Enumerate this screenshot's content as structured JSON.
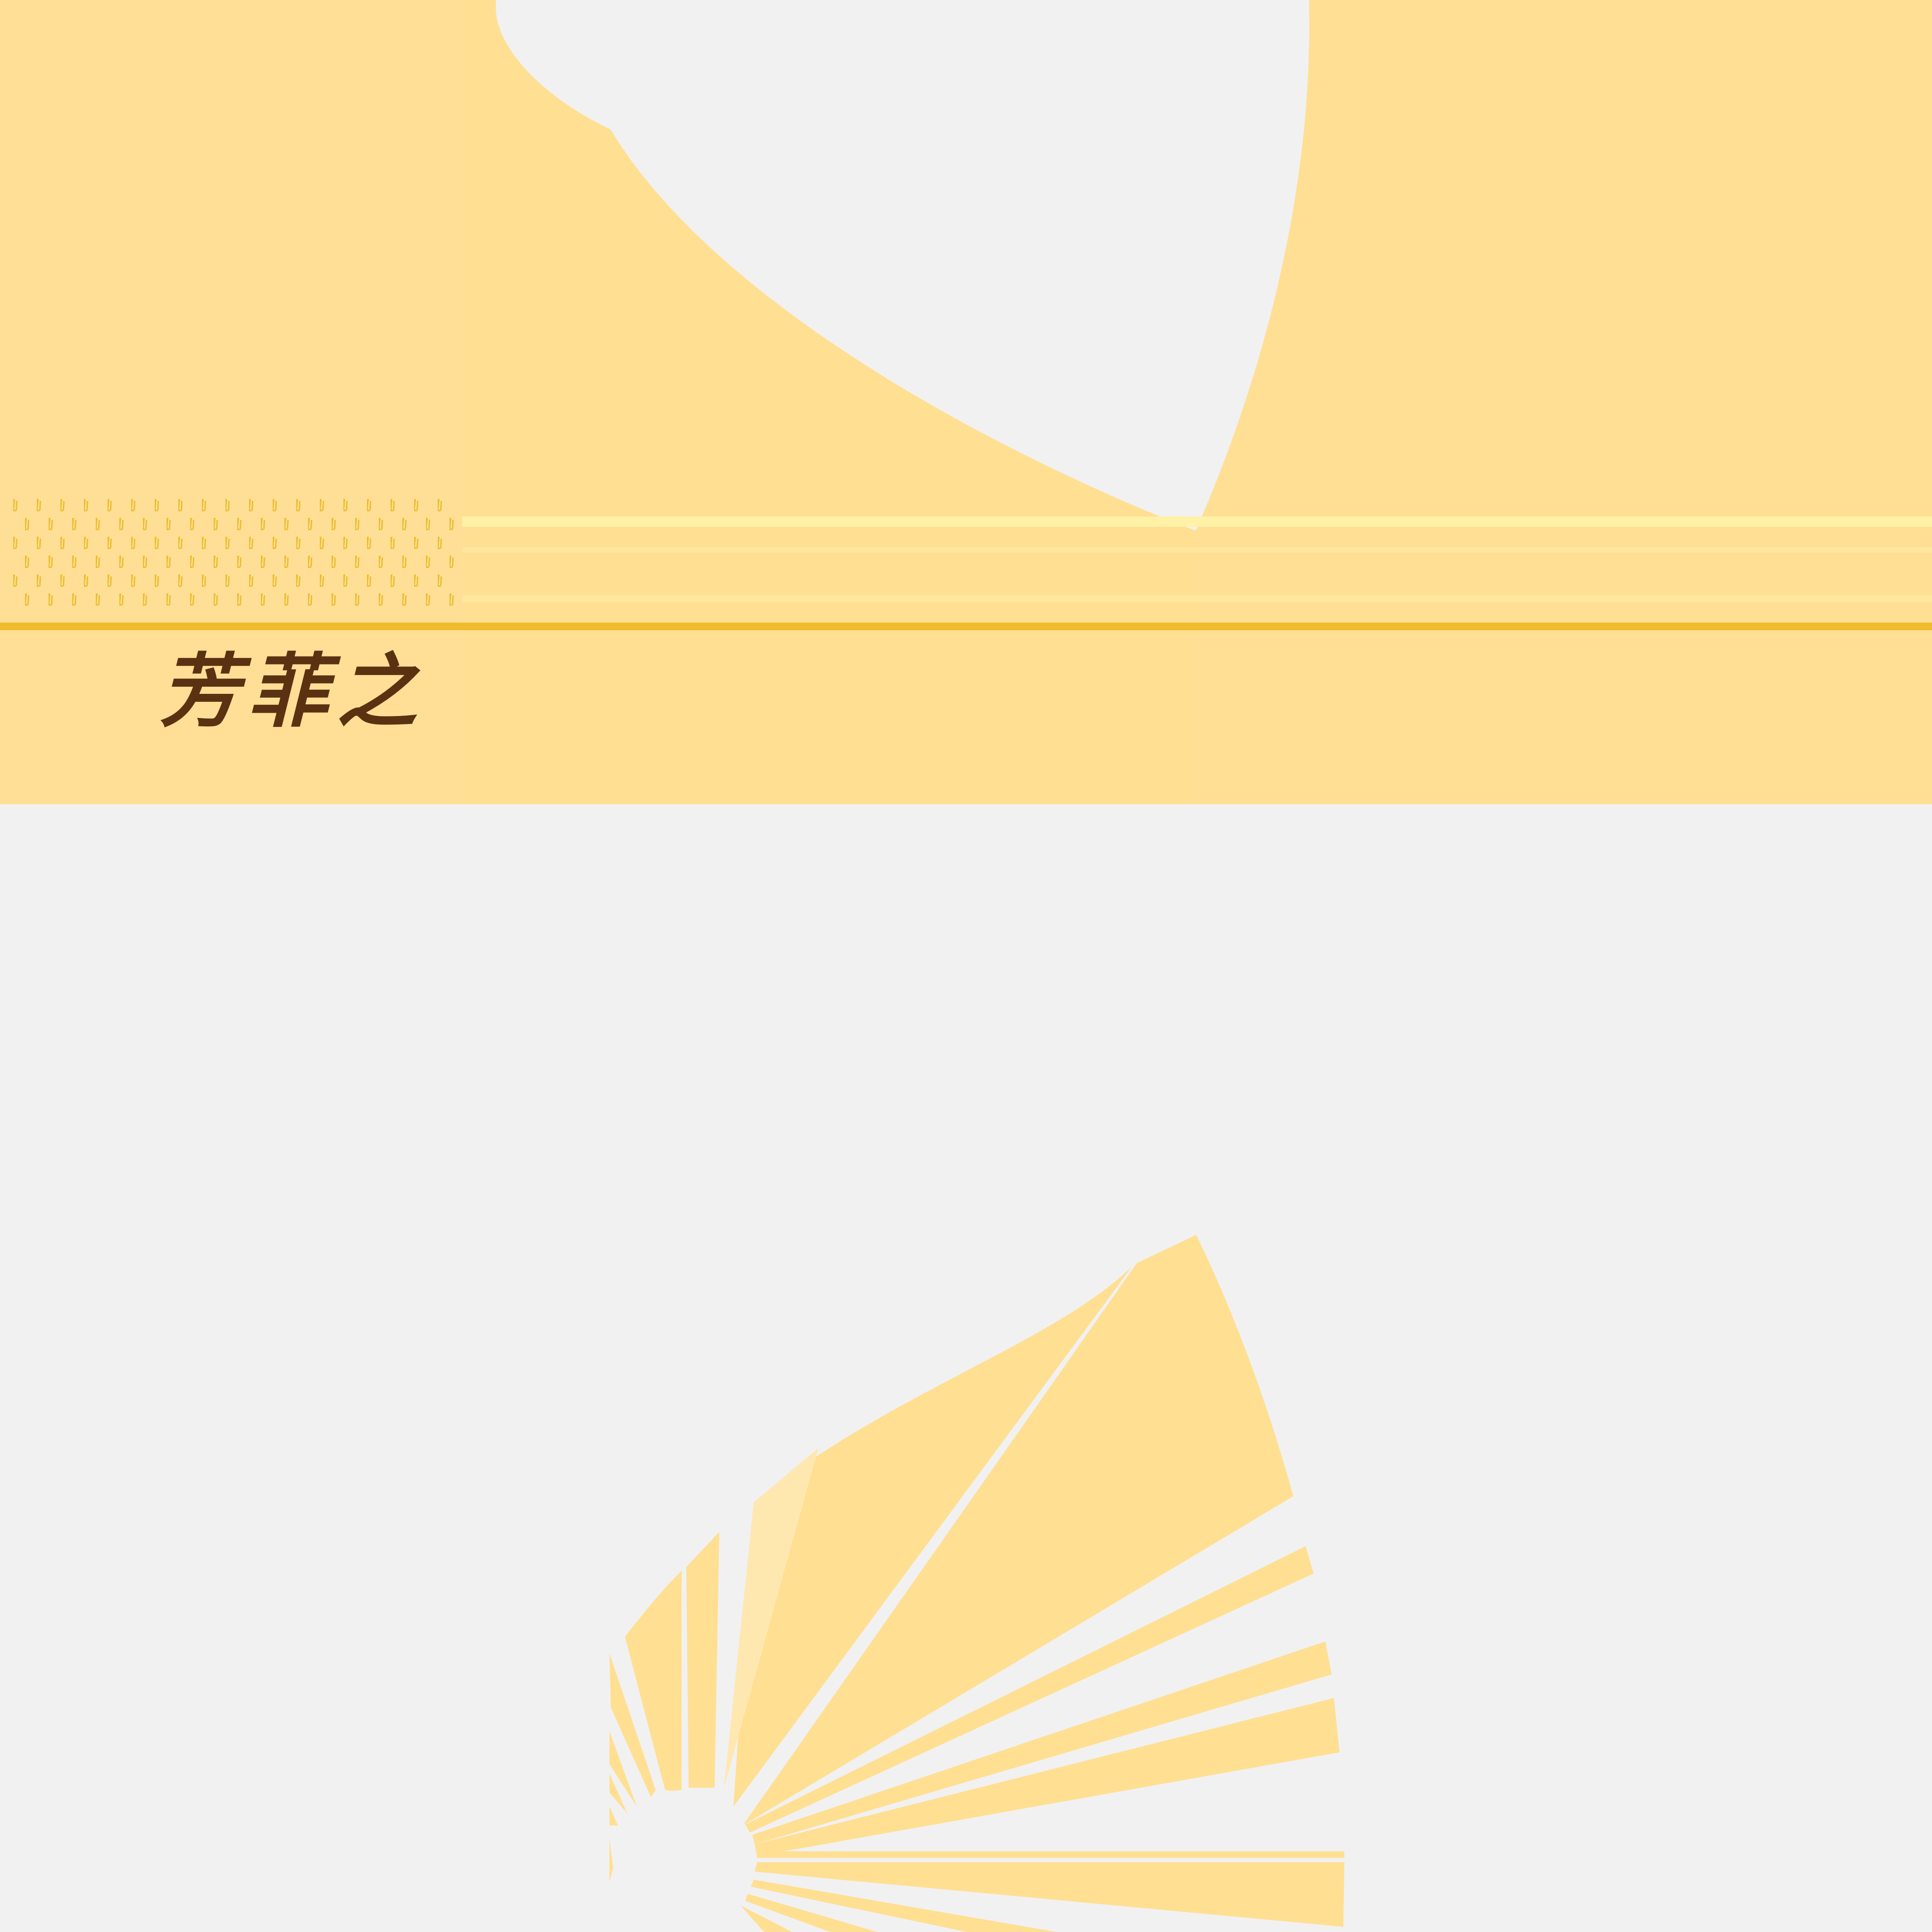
{
  "artwork": {
    "calligraphy_text": "芳菲之",
    "pattern_glyph": "⫽"
  },
  "palette": {
    "background": "#f1f1f1",
    "banner": "#ffdf92",
    "banner_light": "#ffe7a0",
    "stripe_pale": "#fff1a6",
    "gold_line": "#f0bb2c",
    "ink_brown": "#5a3212",
    "pattern_gold": "#e8b820",
    "fan": "#ffdf92",
    "fan_pale": "#ffe8b0"
  },
  "icons": {
    "calligraphy_logo": "calligraphy-logo-icon",
    "sunburst_fan": "sunburst-fan-icon",
    "pattern": "gold-glyph-pattern-icon"
  }
}
